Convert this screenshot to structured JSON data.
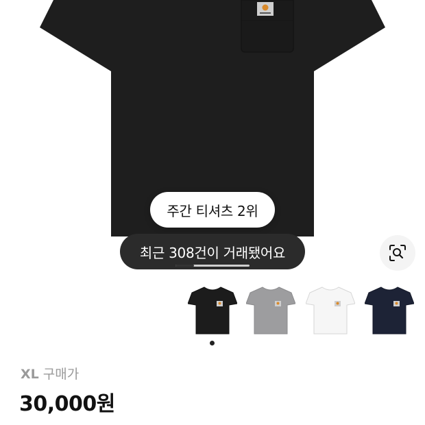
{
  "hero": {
    "rank_badge": "주간 티셔츠 2위",
    "trade_badge": "최근 308건이 거래됐어요",
    "carousel_progress": 0.25,
    "lens_icon": "camera-lens-search-icon"
  },
  "color_options": [
    {
      "name": "black",
      "color": "#1c1c1c",
      "stroke": "#111111"
    },
    {
      "name": "grey",
      "color": "#9d9d9f",
      "stroke": "#8a8a8c"
    },
    {
      "name": "white",
      "color": "#f6f6f6",
      "stroke": "#d6d6d6"
    },
    {
      "name": "navy",
      "color": "#1d2336",
      "stroke": "#151a29"
    }
  ],
  "product": {
    "size": "XL",
    "price_label": "구매가",
    "price": "30,000원"
  },
  "colors": {
    "shirt_main": "#1e1e1e",
    "pill_dark": "#2b2b2b",
    "label_orange": "#d98a2b"
  }
}
